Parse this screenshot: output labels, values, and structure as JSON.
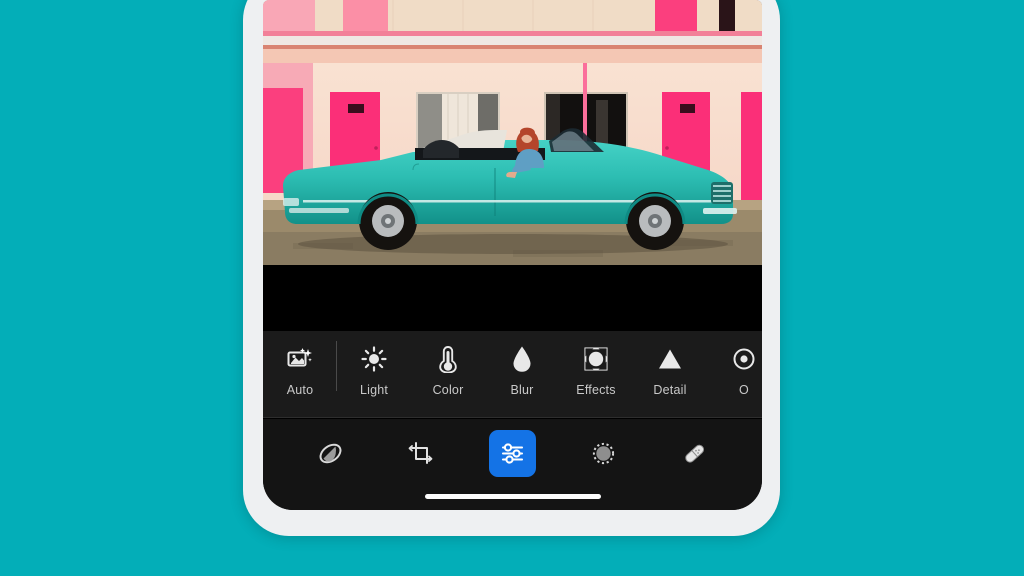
{
  "background": {
    "color": "#03aeb8"
  },
  "device": {
    "frame_color": "#eef0f2",
    "screen_background": "#000000",
    "home_indicator": "home-indicator"
  },
  "photo": {
    "description": "Teal vintage convertible car parked in front of a pink motel with a woman with red hair sitting inside",
    "letterbox_color": "#000000",
    "colors": {
      "car_body": "#2fbfb4",
      "car_body_dark": "#17928c",
      "motel_wall": "#f7d9cb",
      "motel_pink": "#f7a9b8",
      "door_pink": "#fb2f78",
      "ground": "#8d7b5e",
      "upper_soffit": "#f0dcc4",
      "woman_hair": "#b4452b",
      "woman_top": "#5f9fc4"
    }
  },
  "adjust_toolbar": {
    "background": "#1b1b1b",
    "items": [
      {
        "label": "Auto",
        "icon": "auto-enhance-icon"
      },
      {
        "label": "Light",
        "icon": "sun-icon"
      },
      {
        "label": "Color",
        "icon": "thermometer-icon"
      },
      {
        "label": "Blur",
        "icon": "droplet-icon"
      },
      {
        "label": "Effects",
        "icon": "vignette-icon"
      },
      {
        "label": "Detail",
        "icon": "triangle-icon"
      },
      {
        "label": "O",
        "icon": "optics-icon"
      }
    ]
  },
  "bottom_nav": {
    "background": "#141414",
    "selected_color": "#1473e6",
    "selected_index": 2,
    "items": [
      {
        "name": "presets",
        "icon": "presets-icon",
        "selected": false
      },
      {
        "name": "crop",
        "icon": "crop-rotate-icon",
        "selected": false
      },
      {
        "name": "edit",
        "icon": "sliders-icon",
        "selected": true
      },
      {
        "name": "masking",
        "icon": "masking-circle-icon",
        "selected": false
      },
      {
        "name": "healing",
        "icon": "healing-brush-icon",
        "selected": false
      }
    ]
  }
}
